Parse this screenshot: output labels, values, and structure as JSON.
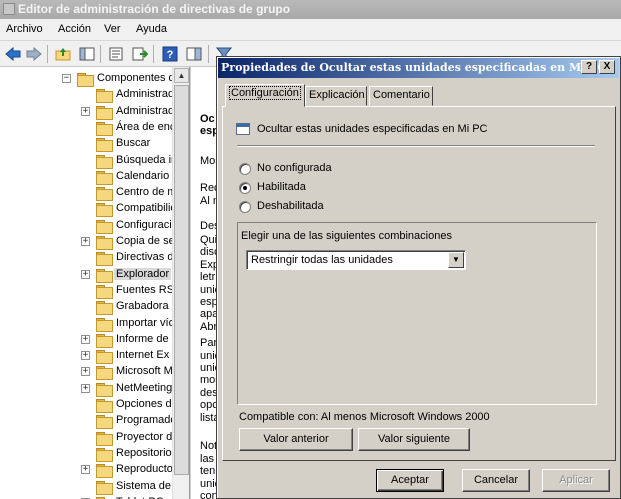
{
  "window": {
    "title": "Editor de administración de directivas de grupo"
  },
  "menu": [
    "Archivo",
    "Acción",
    "Ver",
    "Ayuda"
  ],
  "tree": {
    "items": [
      {
        "label": "Componentes d",
        "expander": "−",
        "indent": 0
      },
      {
        "label": "Administrad",
        "expander": "",
        "indent": 1
      },
      {
        "label": "Administrad",
        "expander": "+",
        "indent": 1
      },
      {
        "label": "Área de enc",
        "expander": "",
        "indent": 1
      },
      {
        "label": "Buscar",
        "expander": "",
        "indent": 1
      },
      {
        "label": "Búsqueda ir",
        "expander": "",
        "indent": 1
      },
      {
        "label": "Calendario c",
        "expander": "",
        "indent": 1
      },
      {
        "label": "Centro de m",
        "expander": "",
        "indent": 1
      },
      {
        "label": "Compatibilic",
        "expander": "",
        "indent": 1
      },
      {
        "label": "Configuració",
        "expander": "",
        "indent": 1
      },
      {
        "label": "Copia de se",
        "expander": "+",
        "indent": 1
      },
      {
        "label": "Directivas d",
        "expander": "",
        "indent": 1
      },
      {
        "label": "Explorador",
        "expander": "+",
        "indent": 1,
        "selected": true
      },
      {
        "label": "Fuentes RSS",
        "expander": "",
        "indent": 1
      },
      {
        "label": "Grabadora c",
        "expander": "",
        "indent": 1
      },
      {
        "label": "Importar vío",
        "expander": "",
        "indent": 1
      },
      {
        "label": "Informe de",
        "expander": "+",
        "indent": 1
      },
      {
        "label": "Internet Ex",
        "expander": "+",
        "indent": 1
      },
      {
        "label": "Microsoft M",
        "expander": "+",
        "indent": 1
      },
      {
        "label": "NetMeeting",
        "expander": "+",
        "indent": 1
      },
      {
        "label": "Opciones de",
        "expander": "",
        "indent": 1
      },
      {
        "label": "Programado",
        "expander": "",
        "indent": 1
      },
      {
        "label": "Proyector d",
        "expander": "",
        "indent": 1
      },
      {
        "label": "Repositorio",
        "expander": "",
        "indent": 1
      },
      {
        "label": "Reproducto",
        "expander": "+",
        "indent": 1
      },
      {
        "label": "Sistema de",
        "expander": "",
        "indent": 1
      },
      {
        "label": "Tablet PC",
        "expander": "+",
        "indent": 1
      }
    ]
  },
  "detail": {
    "lines": [
      {
        "text": "Oc",
        "bold": true
      },
      {
        "text": "esp",
        "bold": true
      },
      {
        "text": "Mos"
      },
      {
        "text": "Rec"
      },
      {
        "text": "Al n"
      },
      {
        "text": "Des"
      },
      {
        "text": "Qui"
      },
      {
        "text": "disc"
      },
      {
        "text": "Exp"
      },
      {
        "text": "letr"
      },
      {
        "text": "unic"
      },
      {
        "text": "esp"
      },
      {
        "text": "apa"
      },
      {
        "text": "Abr"
      },
      {
        "text": "Par"
      },
      {
        "text": "unic"
      },
      {
        "text": "unic"
      },
      {
        "text": "mos"
      },
      {
        "text": "des"
      },
      {
        "text": "opc"
      },
      {
        "text": "lista"
      },
      {
        "text": "Not"
      },
      {
        "text": "las"
      },
      {
        "text": "ten"
      },
      {
        "text": "unic"
      },
      {
        "text": "con"
      }
    ]
  },
  "dialog": {
    "title": "Propiedades de Ocultar estas unidades especificadas en Mi PC",
    "help_btn": "?",
    "close_btn": "X",
    "tabs": [
      "Configuración",
      "Explicación",
      "Comentario"
    ],
    "policy_name": "Ocultar estas unidades especificadas en Mi PC",
    "options": [
      {
        "label": "No configurada",
        "checked": false
      },
      {
        "label": "Habilitada",
        "checked": true
      },
      {
        "label": "Deshabilitada",
        "checked": false
      }
    ],
    "combo_label": "Elegir una de las siguientes combinaciones",
    "combo_value": "Restringir todas las unidades",
    "compat": "Compatible con: Al menos Microsoft Windows 2000",
    "prev_btn": "Valor anterior",
    "next_btn": "Valor siguiente",
    "ok_btn": "Aceptar",
    "cancel_btn": "Cancelar",
    "apply_btn": "Aplicar"
  }
}
